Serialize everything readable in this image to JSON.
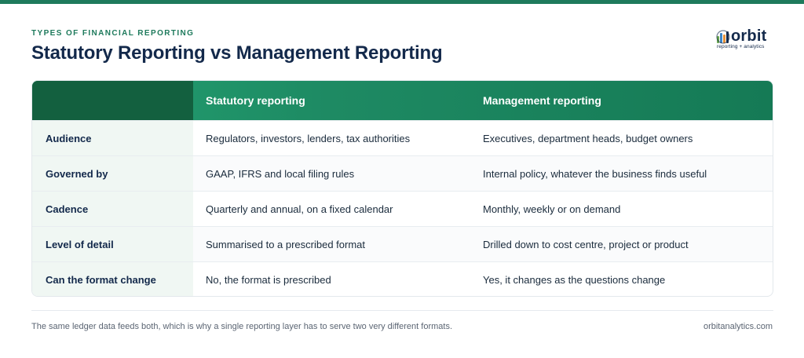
{
  "kicker": "TYPES OF FINANCIAL REPORTING",
  "title": "Statutory Reporting vs Management Reporting",
  "logo": {
    "word": "orbit",
    "tagline": "reporting + analytics"
  },
  "colors": {
    "accent": "#1e7a5c",
    "title": "#13294b",
    "header_dark": "#13603f"
  },
  "table": {
    "headers": [
      "",
      "Statutory reporting",
      "Management reporting"
    ],
    "rows": [
      [
        "Audience",
        "Regulators, investors, lenders, tax authorities",
        "Executives, department heads, budget owners"
      ],
      [
        "Governed by",
        "GAAP, IFRS and local filing rules",
        "Internal policy, whatever the business finds useful"
      ],
      [
        "Cadence",
        "Quarterly and annual, on a fixed calendar",
        "Monthly, weekly or on demand"
      ],
      [
        "Level of detail",
        "Summarised to a prescribed format",
        "Drilled down to cost centre, project or product"
      ],
      [
        "Can the format change",
        "No, the format is prescribed",
        "Yes, it changes as the questions change"
      ]
    ]
  },
  "footer": {
    "note": "The same ledger data feeds both, which is why a single reporting layer has to serve two very different formats.",
    "site": "orbitanalytics.com"
  }
}
